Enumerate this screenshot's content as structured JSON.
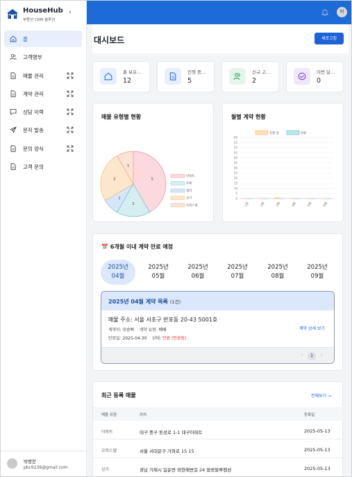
{
  "brand": {
    "name": "HouseHub",
    "subtitle": "부동산 CRM 솔루션"
  },
  "nav": [
    {
      "label": "홈",
      "icon": "home-icon",
      "active": true,
      "expandable": false
    },
    {
      "label": "고객명부",
      "icon": "users-icon",
      "active": false,
      "expandable": false
    },
    {
      "label": "매물 관리",
      "icon": "document-icon",
      "active": false,
      "expandable": true
    },
    {
      "label": "계약 관리",
      "icon": "document-icon",
      "active": false,
      "expandable": true
    },
    {
      "label": "상담 이력",
      "icon": "chat-icon",
      "active": false,
      "expandable": true
    },
    {
      "label": "문자 발송",
      "icon": "send-icon",
      "active": false,
      "expandable": true
    },
    {
      "label": "문의 양식",
      "icon": "document-icon",
      "active": false,
      "expandable": true
    },
    {
      "label": "고객 문의",
      "icon": "document-icon",
      "active": false,
      "expandable": false
    }
  ],
  "user": {
    "name": "박병찬",
    "email": "pbc9236@gmail.com",
    "avatar_initial": "박"
  },
  "header": {
    "title": "대시보드",
    "refresh_label": "새로고침"
  },
  "stats": [
    {
      "label": "총 보유...",
      "value": "12",
      "icon": "home-icon",
      "color": "#2a6fdb",
      "bg": "#e6effc"
    },
    {
      "label": "진행 중...",
      "value": "5",
      "icon": "document-icon",
      "color": "#2a6fdb",
      "bg": "#e6effc"
    },
    {
      "label": "신규 고...",
      "value": "2",
      "icon": "users-icon",
      "color": "#2e9e5b",
      "bg": "#e4f5ea"
    },
    {
      "label": "이번 달...",
      "value": "0",
      "icon": "check-circle-icon",
      "color": "#7b46d9",
      "bg": "#efe7fb"
    }
  ],
  "property_chart": {
    "title": "매물 유형별 현황",
    "chart_data": {
      "type": "pie",
      "labels": [
        "아파트",
        "주택",
        "빌라",
        "상가",
        "오피스텔"
      ],
      "values": [
        5,
        2,
        1,
        3,
        1
      ],
      "colors": [
        "#fbd9df",
        "#d7eef0",
        "#d6e6f8",
        "#fde7cc",
        "#fbe3d6"
      ],
      "strokes": [
        "#f08aa0",
        "#6cc3c9",
        "#7aaee8",
        "#f2b56b",
        "#f2a27b"
      ]
    }
  },
  "contract_chart": {
    "title": "월별 계약 현황",
    "chart_data": {
      "type": "bar",
      "categories": [
        "1월",
        "2월",
        "3월",
        "4월",
        "5월",
        "6월"
      ],
      "series": [
        {
          "name": "진행 중",
          "values": [
            0,
            0,
            1,
            0,
            0,
            0
          ],
          "color": "#fbe0b3",
          "stroke": "#f2b56b"
        },
        {
          "name": "완료",
          "values": [
            0,
            0,
            0,
            0,
            0,
            0
          ],
          "color": "#bfe6e8",
          "stroke": "#49b3b9"
        }
      ],
      "yticks": [
        "60",
        "55",
        "50",
        "45",
        "40",
        "35",
        "30",
        "25",
        "20",
        "15",
        "10",
        "5",
        "0"
      ],
      "ylim": [
        0,
        60
      ]
    }
  },
  "expiring": {
    "emoji": "📅",
    "title": "6개월 이내 계약 만료 예정",
    "months": [
      {
        "year": "2025년",
        "month": "04월",
        "active": true
      },
      {
        "year": "2025년",
        "month": "05월",
        "active": false
      },
      {
        "year": "2025년",
        "month": "06월",
        "active": false
      },
      {
        "year": "2025년",
        "month": "07월",
        "active": false
      },
      {
        "year": "2025년",
        "month": "08월",
        "active": false
      },
      {
        "year": "2025년",
        "month": "09월",
        "active": false
      }
    ],
    "list_title": "2025년 04월 계약 목록",
    "list_count": "(1건)",
    "item": {
      "address": "매물 주소: 서울 서초구 반포동 20-43 5001호",
      "contractor_label": "계약자:",
      "contractor": "오승택",
      "type_label": "계약 유형:",
      "type": "매매",
      "end_label": "만료일:",
      "end_date": "2025-04-30",
      "status_label": "상태:",
      "status": "만료 (만료됨)",
      "detail_link": "계약 상세 보기"
    },
    "page": "1",
    "prev": "‹",
    "next": "›"
  },
  "recent": {
    "title": "최근 등록 매물",
    "view_all": "전체보기 →",
    "columns": [
      "매물 유형",
      "위치",
      "등록일"
    ],
    "rows": [
      {
        "type": "아파트",
        "location": "대구 중구 동성로 1-1 대구아파트",
        "date": "2025-05-13"
      },
      {
        "type": "오피스텔",
        "location": "서울 서대문구 가좌로 15 15",
        "date": "2025-05-13"
      },
      {
        "type": "상가",
        "location": "경남 거제시 일운면 와현해변길 24 블랑블루펜션",
        "date": "2025-05-13"
      }
    ]
  }
}
